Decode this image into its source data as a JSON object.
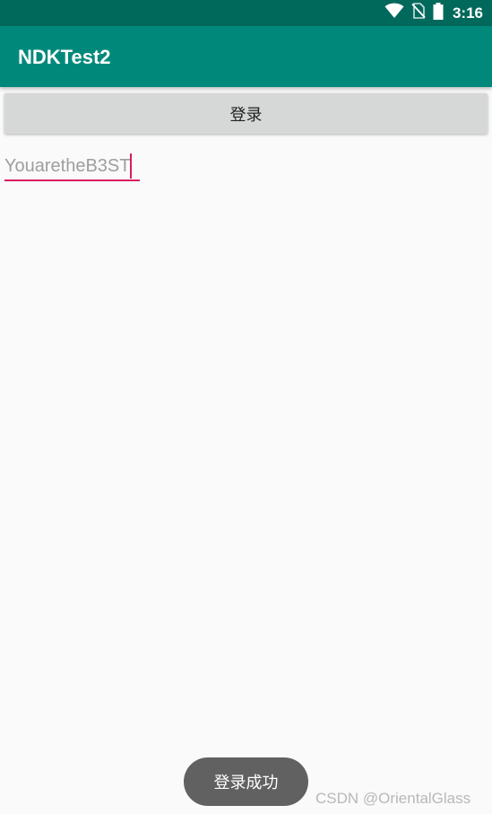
{
  "status_bar": {
    "time": "3:16",
    "icons": [
      "wifi-icon",
      "no-sim-icon",
      "battery-icon"
    ],
    "background": "#00695c"
  },
  "app_bar": {
    "title": "NDKTest2",
    "background": "#00897b"
  },
  "login_button": {
    "label": "登录"
  },
  "input": {
    "value": "YouaretheB3ST",
    "accent": "#d81b60"
  },
  "toast": {
    "message": "登录成功"
  },
  "watermark": {
    "text": "CSDN @OrientalGlass"
  }
}
